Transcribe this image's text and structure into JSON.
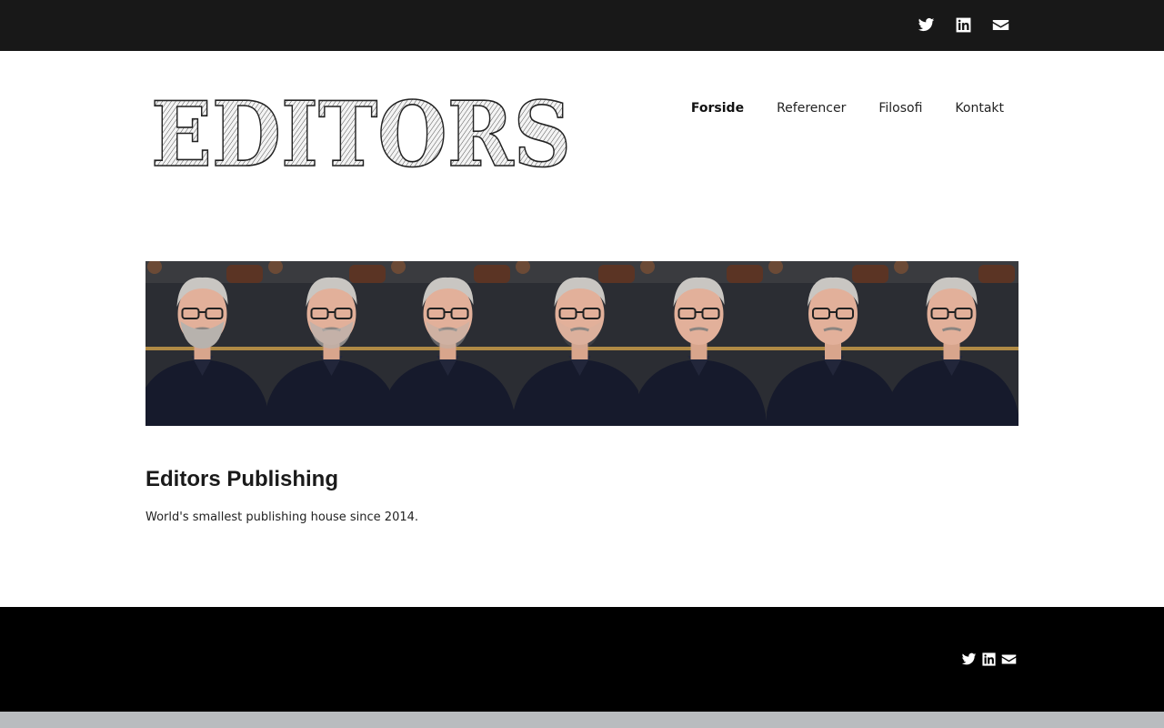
{
  "colors": {
    "topbar_bg": "#181818",
    "footer_bg": "#000000",
    "bottombar_bg": "#b9bcbf",
    "text": "#1a1a1a"
  },
  "header_social": [
    {
      "icon": "twitter-icon"
    },
    {
      "icon": "linkedin-icon"
    },
    {
      "icon": "email-icon"
    }
  ],
  "logo": {
    "text": "EDITORS"
  },
  "nav": {
    "items": [
      {
        "label": "Forside",
        "active": true
      },
      {
        "label": "Referencer",
        "active": false
      },
      {
        "label": "Filosofi",
        "active": false
      },
      {
        "label": "Kontakt",
        "active": false
      }
    ]
  },
  "banner": {
    "panels": 7,
    "description_icon": "portrait-sequence-image"
  },
  "main": {
    "title": "Editors Publishing",
    "tagline": "World's smallest publishing house since 2014."
  },
  "footer_social": [
    {
      "icon": "twitter-icon"
    },
    {
      "icon": "linkedin-icon"
    },
    {
      "icon": "email-icon"
    }
  ]
}
